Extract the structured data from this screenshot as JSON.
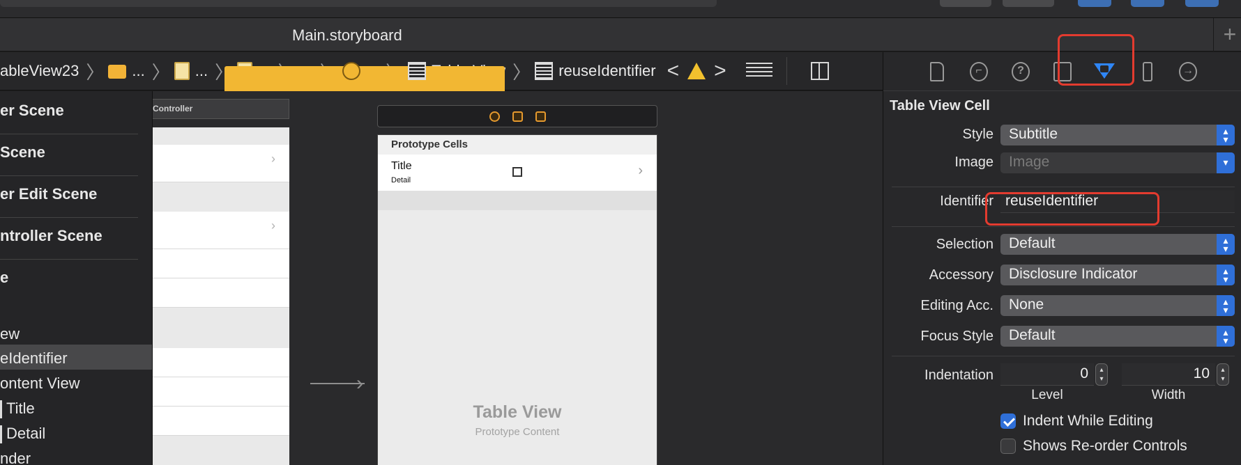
{
  "tabbar": {
    "title": "Main.storyboard",
    "add_label": "+"
  },
  "jumpbar": {
    "crumbs": [
      {
        "label": "ableView23",
        "icon": "folder-icon"
      },
      {
        "label": "...",
        "icon": "folder-icon"
      },
      {
        "label": "...",
        "icon": "storyboard-file-icon"
      },
      {
        "label": "...",
        "icon": "storyboard-file-icon"
      },
      {
        "label": "...",
        "icon": "scene-icon"
      },
      {
        "label": "...",
        "icon": "view-controller-icon"
      },
      {
        "label": "Table View",
        "icon": "table-view-icon"
      },
      {
        "label": "reuseIdentifier",
        "icon": "table-cell-icon"
      }
    ],
    "back": "<",
    "forward": ">"
  },
  "outline": {
    "items": [
      {
        "label": "er Scene",
        "bold": true
      },
      {
        "label": "Scene",
        "bold": true
      },
      {
        "label": "er Edit Scene",
        "bold": true
      },
      {
        "label": "ntroller Scene",
        "bold": true
      },
      {
        "label": "e",
        "bold": true
      },
      {
        "label": "ew",
        "bold": false
      },
      {
        "label": "eIdentifier",
        "bold": false
      },
      {
        "label": "ontent View",
        "bold": false
      },
      {
        "label": "Title",
        "bold": false
      },
      {
        "label": "Detail",
        "bold": false
      },
      {
        "label": "nder",
        "bold": false
      }
    ]
  },
  "canvas": {
    "partial_scene_title": "Controller",
    "prototype_header": "Prototype Cells",
    "cell_title": "Title",
    "cell_detail": "Detail",
    "chevron": "›",
    "table_view_label": "Table View",
    "prototype_content_label": "Prototype Content"
  },
  "inspector": {
    "section_title": "Table View Cell",
    "style": {
      "label": "Style",
      "value": "Subtitle"
    },
    "image": {
      "label": "Image",
      "placeholder": "Image"
    },
    "identifier": {
      "label": "Identifier",
      "value": "reuseIdentifier"
    },
    "selection": {
      "label": "Selection",
      "value": "Default"
    },
    "accessory": {
      "label": "Accessory",
      "value": "Disclosure Indicator"
    },
    "editing_acc": {
      "label": "Editing Acc.",
      "value": "None"
    },
    "focus_style": {
      "label": "Focus Style",
      "value": "Default"
    },
    "indentation": {
      "label": "Indentation",
      "level_value": "0",
      "width_value": "10",
      "level_label": "Level",
      "width_label": "Width"
    },
    "indent_while_editing": {
      "label": "Indent While Editing",
      "checked": true
    },
    "shows_reorder": {
      "label": "Shows Re-order Controls",
      "checked": false
    }
  },
  "colors": {
    "accent": "#2f86f6",
    "highlight": "#e33b2f",
    "warning": "#f2c12e"
  }
}
